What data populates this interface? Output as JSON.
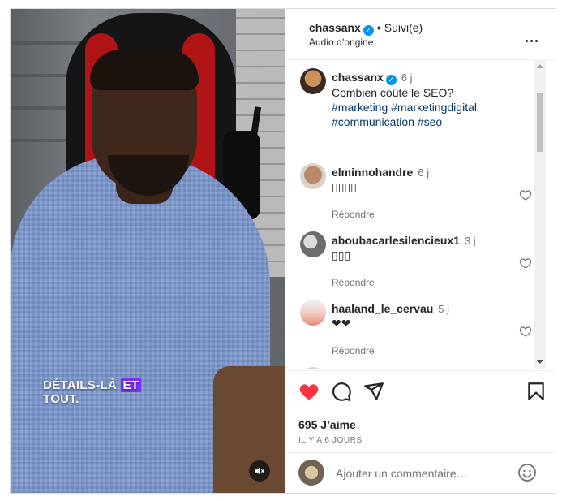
{
  "video": {
    "caption_line1_before": "DÉTAILS-LÀ ",
    "caption_highlight": "ET",
    "caption_line2": "TOUT.",
    "mute_icon": "speaker-muted-icon"
  },
  "header": {
    "username": "chassanx",
    "separator": "•",
    "follow_status": "Suivi(e)",
    "audio": "Audio d’origine",
    "more_icon": "more-horizontal-icon"
  },
  "post": {
    "username": "chassanx",
    "time": "6 j",
    "text": "Combien coûte le SEO?",
    "tags_line1": "#marketing #marketingdigital",
    "tags_line2": "#communication #seo"
  },
  "comments": [
    {
      "username": "elminnohandre",
      "time": "6 j",
      "text": "▯▯▯▯",
      "reply": "Répondre"
    },
    {
      "username": "aboubacarlesilencieux1",
      "time": "3 j",
      "text": "▯▯▯",
      "reply": "Répondre"
    },
    {
      "username": "haaland_le_cervau",
      "time": "5 j",
      "text": "❤❤",
      "reply": "Répondre"
    }
  ],
  "actions": {
    "likes": "695 J’aime",
    "ago": "IL Y A 6 JOURS",
    "liked": true,
    "like_color": "#ff3040"
  },
  "add_comment": {
    "placeholder": "Ajouter un commentaire…"
  },
  "colors": {
    "verified": "#0095f6",
    "link": "#00376b",
    "caption_highlight": "#7b2ff7"
  }
}
